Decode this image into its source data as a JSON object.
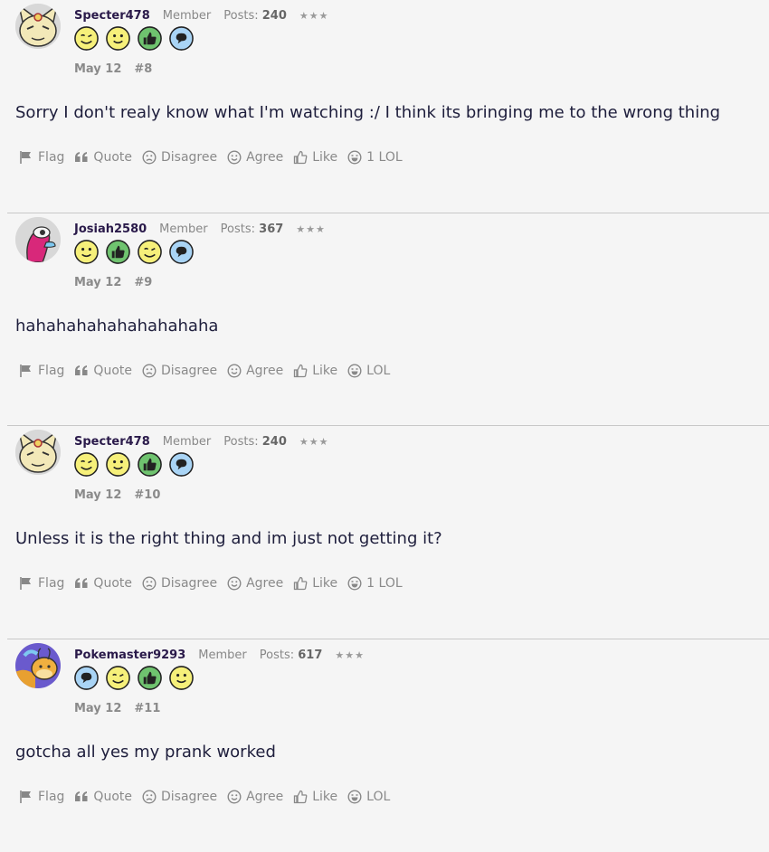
{
  "posts": [
    {
      "username": "Specter478",
      "usertitle": "Member",
      "posts_label": "Posts:",
      "posts_count": "240",
      "stars": "★★★",
      "avatar": "meowth",
      "badges": [
        "wink-badge",
        "smile-badge",
        "thumbs-up-badge",
        "chat-badge"
      ],
      "date": "May 12",
      "number": "#8",
      "message": "Sorry I don't realy know what I'm watching :/ I think its bringing me to the wrong thing",
      "actions": {
        "flag": "Flag",
        "quote": "Quote",
        "disagree": "Disagree",
        "agree": "Agree",
        "like": "Like",
        "lol": "1 LOL"
      }
    },
    {
      "username": "Josiah2580",
      "usertitle": "Member",
      "posts_label": "Posts:",
      "posts_count": "367",
      "stars": "★★★",
      "avatar": "porygon",
      "badges": [
        "smile-badge",
        "thumbs-up-badge",
        "wink-badge",
        "chat-badge"
      ],
      "date": "May 12",
      "number": "#9",
      "message": "hahahahahahahahahaha",
      "actions": {
        "flag": "Flag",
        "quote": "Quote",
        "disagree": "Disagree",
        "agree": "Agree",
        "like": "Like",
        "lol": "LOL"
      }
    },
    {
      "username": "Specter478",
      "usertitle": "Member",
      "posts_label": "Posts:",
      "posts_count": "240",
      "stars": "★★★",
      "avatar": "meowth",
      "badges": [
        "wink-badge",
        "smile-badge",
        "thumbs-up-badge",
        "chat-badge"
      ],
      "date": "May 12",
      "number": "#10",
      "message": "Unless it is the right thing and im just not getting it?",
      "actions": {
        "flag": "Flag",
        "quote": "Quote",
        "disagree": "Disagree",
        "agree": "Agree",
        "like": "Like",
        "lol": "1 LOL"
      }
    },
    {
      "username": "Pokemaster9293",
      "usertitle": "Member",
      "posts_label": "Posts:",
      "posts_count": "617",
      "stars": "★★★",
      "avatar": "dragonite",
      "badges": [
        "chat-badge",
        "wink-badge",
        "thumbs-up-badge",
        "smile-badge"
      ],
      "date": "May 12",
      "number": "#11",
      "message": "gotcha all yes my prank worked",
      "actions": {
        "flag": "Flag",
        "quote": "Quote",
        "disagree": "Disagree",
        "agree": "Agree",
        "like": "Like",
        "lol": "LOL"
      }
    }
  ],
  "colors": {
    "username": "#2a1a4a",
    "muted": "#8a8a8a",
    "background": "#f5f5f5",
    "divider": "#c8c8c8"
  }
}
